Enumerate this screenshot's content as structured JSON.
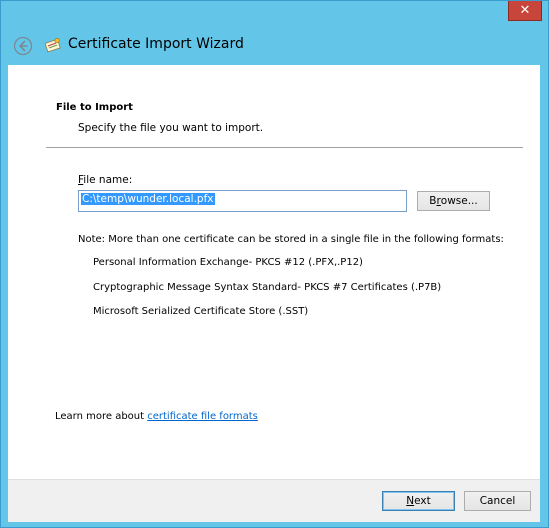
{
  "window": {
    "title": "Certificate Import Wizard",
    "close_symbol": "✕"
  },
  "section": {
    "title": "File to Import",
    "description": "Specify the file you want to import."
  },
  "file": {
    "label_accel": "F",
    "label_rest": "ile name:",
    "value": "C:\\temp\\wunder.local.pfx",
    "browse_accel": "r",
    "browse_pre": "B",
    "browse_post": "owse..."
  },
  "note": {
    "text": "Note:  More than one certificate can be stored in a single file in the following formats:",
    "formats": [
      "Personal Information Exchange- PKCS #12 (.PFX,.P12)",
      "Cryptographic Message Syntax Standard- PKCS #7 Certificates (.P7B)",
      "Microsoft Serialized Certificate Store (.SST)"
    ]
  },
  "learn_more": {
    "prefix": "Learn more about ",
    "link": "certificate file formats"
  },
  "footer": {
    "next_accel": "N",
    "next_rest": "ext",
    "cancel": "Cancel"
  },
  "colors": {
    "titlebar": "#63c6e9",
    "close": "#c7453a",
    "selection": "#3399ff",
    "link": "#0066cc"
  }
}
